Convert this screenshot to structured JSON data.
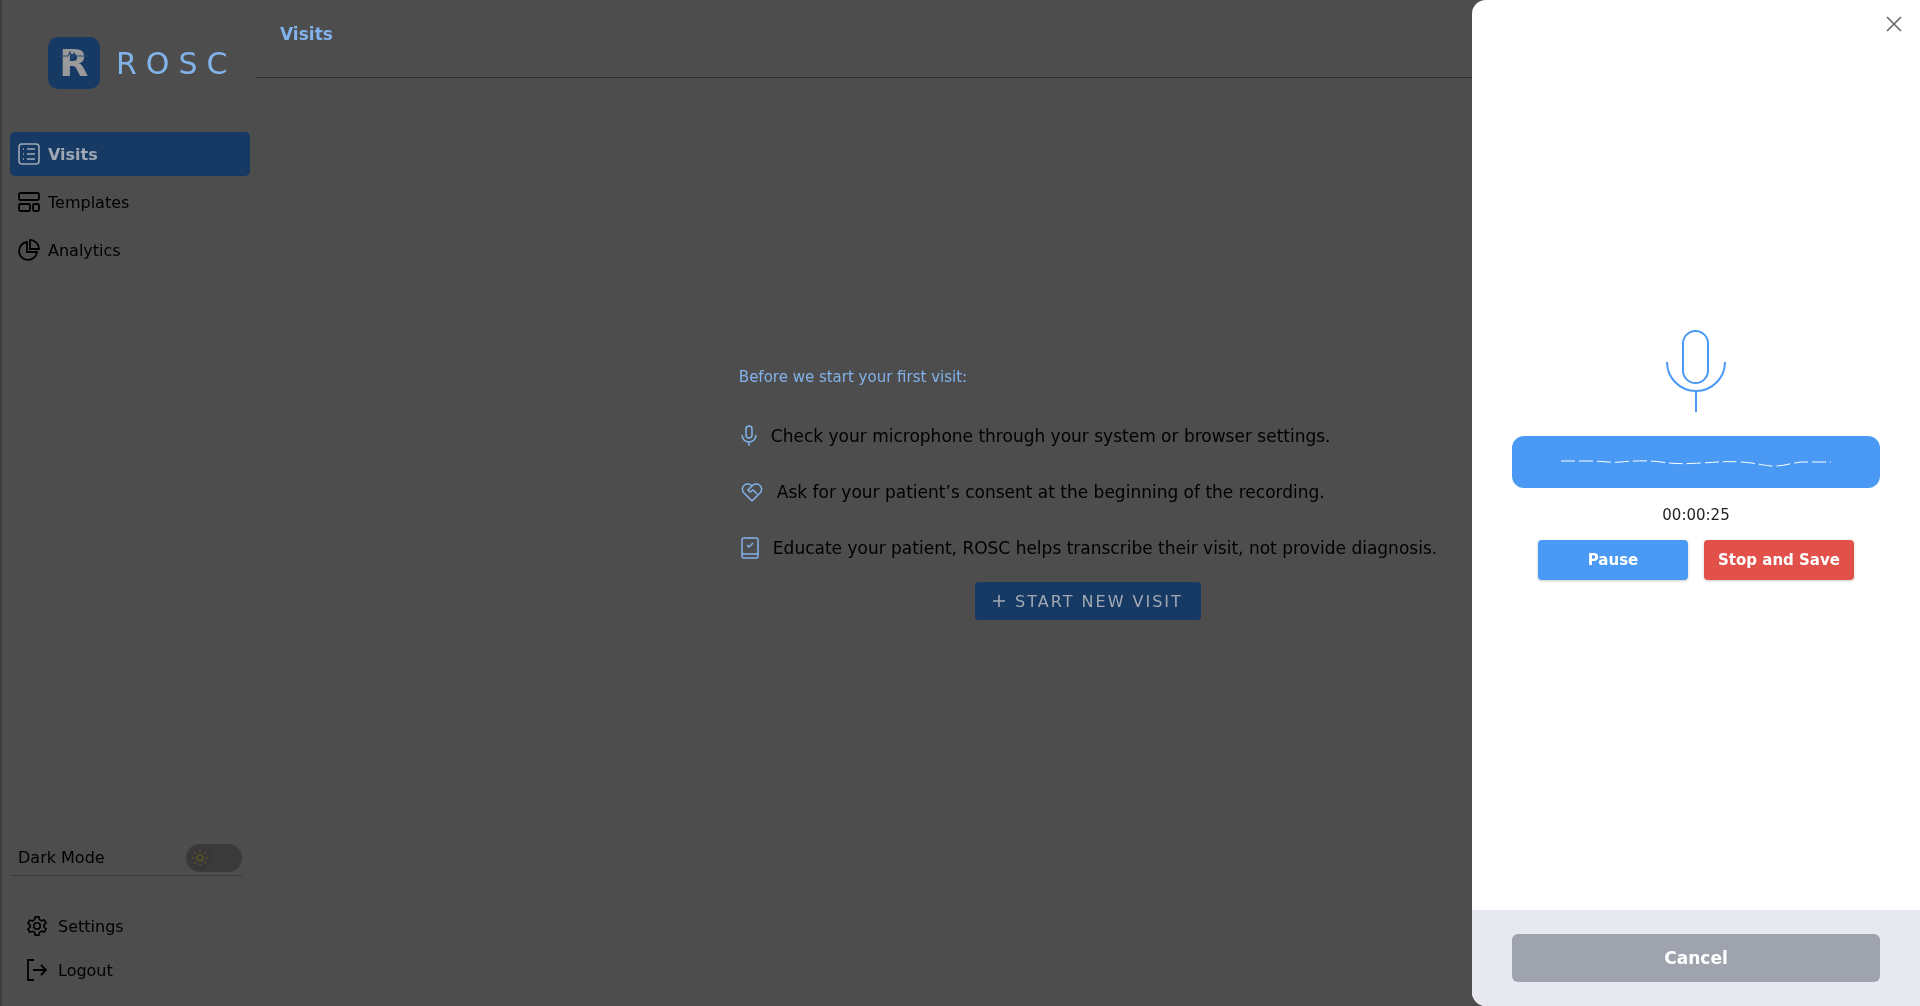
{
  "sidebar": {
    "logo": {
      "mark": "R",
      "name": "ROSC"
    },
    "nav_items": [
      {
        "label": "Visits",
        "selected": true
      },
      {
        "label": "Templates",
        "selected": false
      },
      {
        "label": "Analytics",
        "selected": false
      }
    ],
    "dark_mode": {
      "label": "Dark Mode",
      "on": false
    },
    "footer_items": [
      {
        "kind": "settings",
        "label": "Settings"
      },
      {
        "kind": "logout",
        "label": "Logout"
      }
    ]
  },
  "header": {
    "title": "Visits"
  },
  "onboarding": {
    "heading": "Before we start your first visit:",
    "tips": [
      {
        "kind": "microphone",
        "text": "Check your microphone through your system or browser settings."
      },
      {
        "kind": "consent",
        "text": "Ask for your patient’s consent at the beginning of the recording."
      },
      {
        "kind": "education",
        "text": "Educate your patient, ROSC helps transcribe their visit, not provide diagnosis."
      }
    ],
    "start_button": "START NEW VISIT"
  },
  "recorder": {
    "timer": "00:00:25",
    "buttons": [
      {
        "kind": "pause",
        "label": "Pause"
      },
      {
        "kind": "stop",
        "label": "Stop and Save"
      }
    ],
    "cancel": "Cancel"
  }
}
